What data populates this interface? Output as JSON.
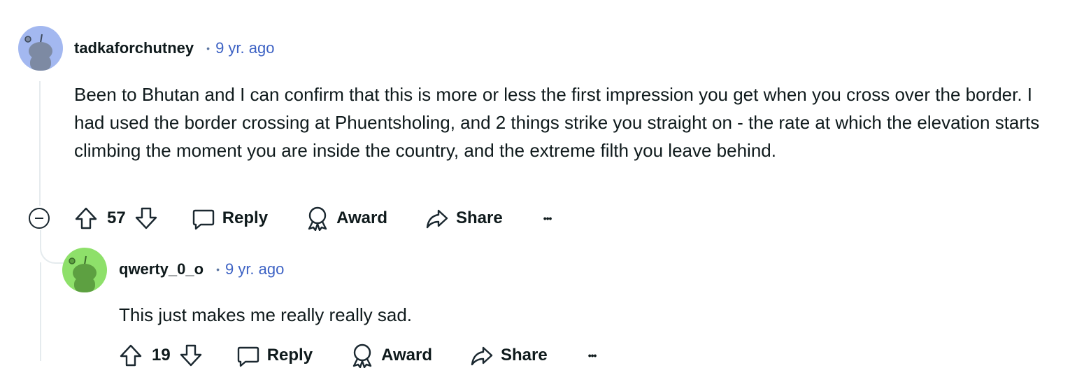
{
  "comments": [
    {
      "username": "tadkaforchutney",
      "separator": "•",
      "time": "9 yr. ago",
      "body": "Been to Bhutan and I can confirm that this is more or less the first impression you get when you cross over the border. I had used the border crossing at Phuentsholing, and 2 things strike you straight on - the rate at which the elevation starts climbing the moment you are inside the country, and the extreme filth you leave behind.",
      "score": "57",
      "reply_label": "Reply",
      "award_label": "Award",
      "share_label": "Share",
      "more_label": "•••",
      "avatar_color": "#a3b8f0"
    },
    {
      "username": "qwerty_0_o",
      "separator": "•",
      "time": "9 yr. ago",
      "body": "This just makes me really really sad.",
      "score": "19",
      "reply_label": "Reply",
      "award_label": "Award",
      "share_label": "Share",
      "more_label": "•••",
      "avatar_color": "#8ee06a"
    }
  ],
  "icons": {
    "upvote": "arrow-up-icon",
    "downvote": "arrow-down-icon",
    "reply": "speech-bubble-icon",
    "award": "award-ribbon-icon",
    "share": "share-arrow-icon",
    "collapse": "minus-circle-icon"
  }
}
